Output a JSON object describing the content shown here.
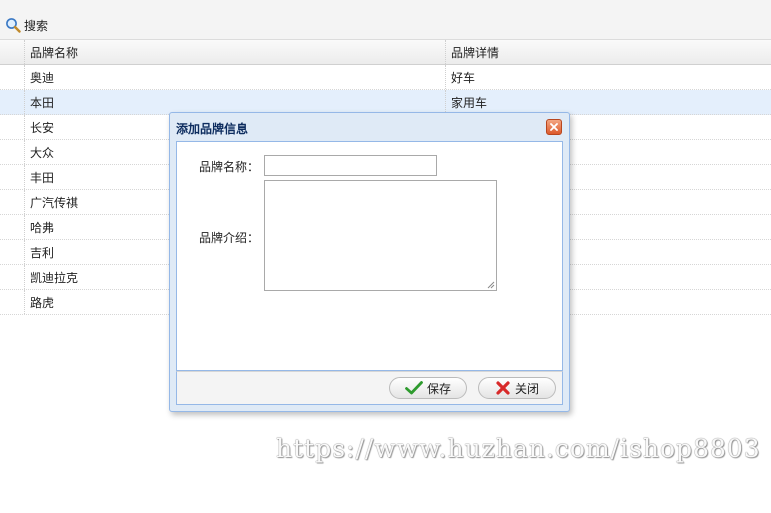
{
  "toolbar": {
    "search_label": "搜索"
  },
  "grid": {
    "headers": {
      "name": "品牌名称",
      "detail": "品牌详情"
    },
    "rows": [
      {
        "name": "奥迪",
        "detail": "好车"
      },
      {
        "name": "本田",
        "detail": "家用车"
      },
      {
        "name": "长安",
        "detail": ""
      },
      {
        "name": "大众",
        "detail": ""
      },
      {
        "name": "丰田",
        "detail": ""
      },
      {
        "name": "广汽传祺",
        "detail": ""
      },
      {
        "name": "哈弗",
        "detail": ""
      },
      {
        "name": "吉利",
        "detail": ""
      },
      {
        "name": "凯迪拉克",
        "detail": ""
      },
      {
        "name": "路虎",
        "detail": ""
      }
    ]
  },
  "dialog": {
    "title": "添加品牌信息",
    "name_label": "品牌名称：",
    "name_value": "",
    "intro_label": "品牌介绍：",
    "intro_value": "",
    "save_label": "保存",
    "close_label": "关闭"
  },
  "watermark": "https://www.huzhan.com/ishop8803",
  "colors": {
    "selected_row": "#e4effc",
    "dialog_border": "#95b8e7",
    "title_text": "#0e2d5f"
  }
}
